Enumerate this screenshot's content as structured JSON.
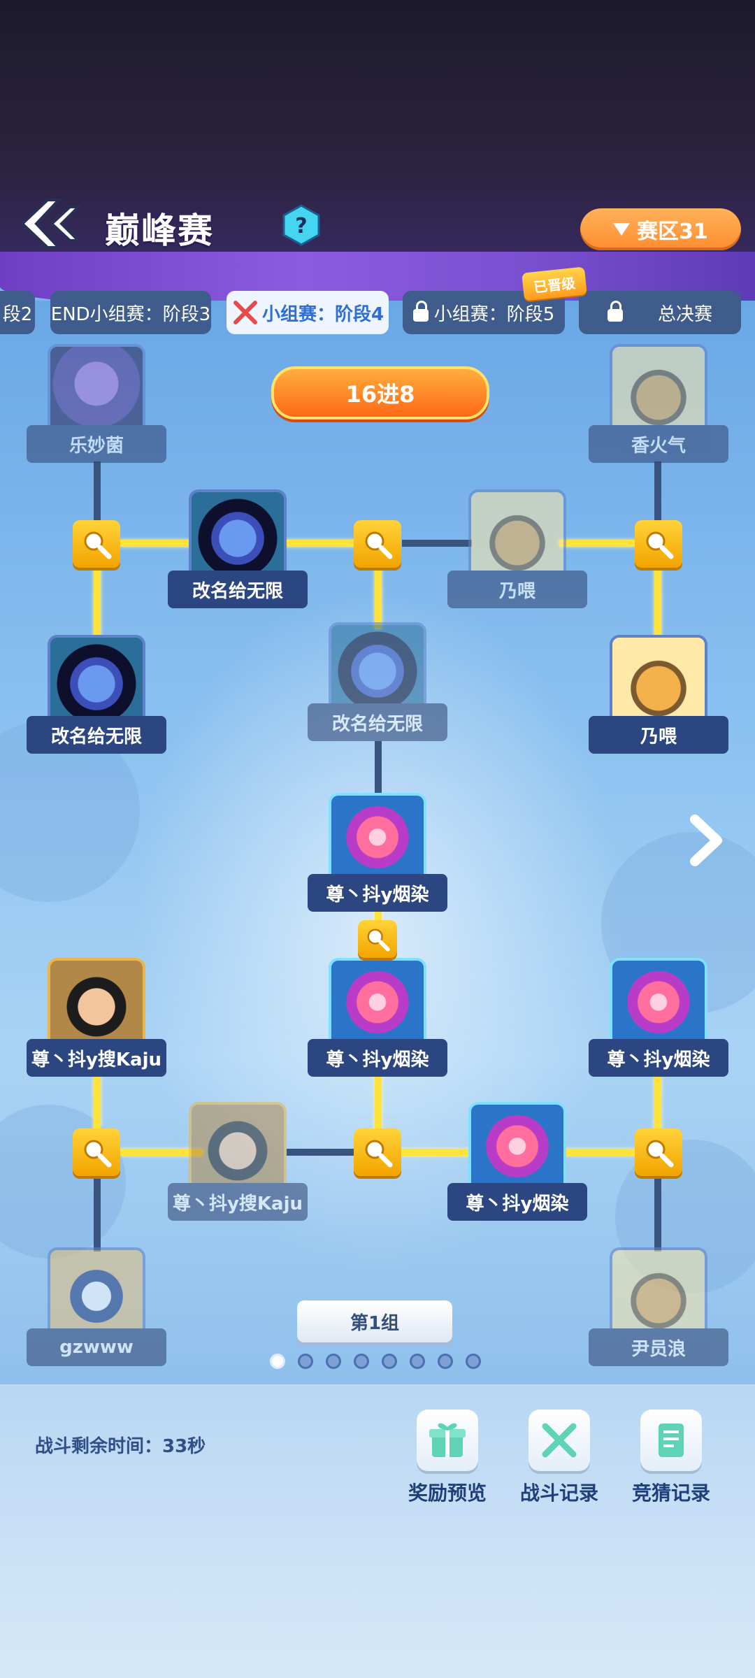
{
  "header": {
    "title": "巅峰赛",
    "help_symbol": "?",
    "zone_label": "赛区31"
  },
  "tabs": [
    {
      "label": "段2",
      "state": "partial"
    },
    {
      "label": "END小组赛：阶段3",
      "state": "done"
    },
    {
      "label": "小组赛：阶段4",
      "state": "active"
    },
    {
      "label": "小组赛：阶段5",
      "state": "locked"
    },
    {
      "label": "总决赛",
      "state": "locked"
    }
  ],
  "upgrade_badge": "已晋级",
  "round_label": "16进8",
  "players": {
    "tl1": "乐妙菌",
    "tr1": "香火气",
    "ql_top": "改名给无限",
    "qr_top": "乃喂",
    "l2": "改名给无限",
    "c_top": "改名给无限",
    "r2": "乃喂",
    "winner": "尊丶抖y烟染",
    "l3": "尊丶抖y搜Kaju",
    "c_bottom": "尊丶抖y烟染",
    "r3": "尊丶抖y烟染",
    "ql_bottom": "尊丶抖y搜Kaju",
    "qr_bottom": "尊丶抖y烟染",
    "bl1": "gzwww",
    "br1": "尹员浪"
  },
  "group_label": "第1组",
  "pagination": {
    "total": 8,
    "current": 1
  },
  "bottom": {
    "timer_text": "战斗剩余时间：33秒",
    "buttons": [
      {
        "label": "奖励预览",
        "icon": "gift-icon"
      },
      {
        "label": "战斗记录",
        "icon": "crossed-swords-icon"
      },
      {
        "label": "竞猜记录",
        "icon": "document-icon"
      }
    ]
  },
  "colors": {
    "accent": "#ff8c2e",
    "line_active": "#ffe23a",
    "plate": "#2c4682",
    "active_tab_text": "#2d6fd6"
  }
}
